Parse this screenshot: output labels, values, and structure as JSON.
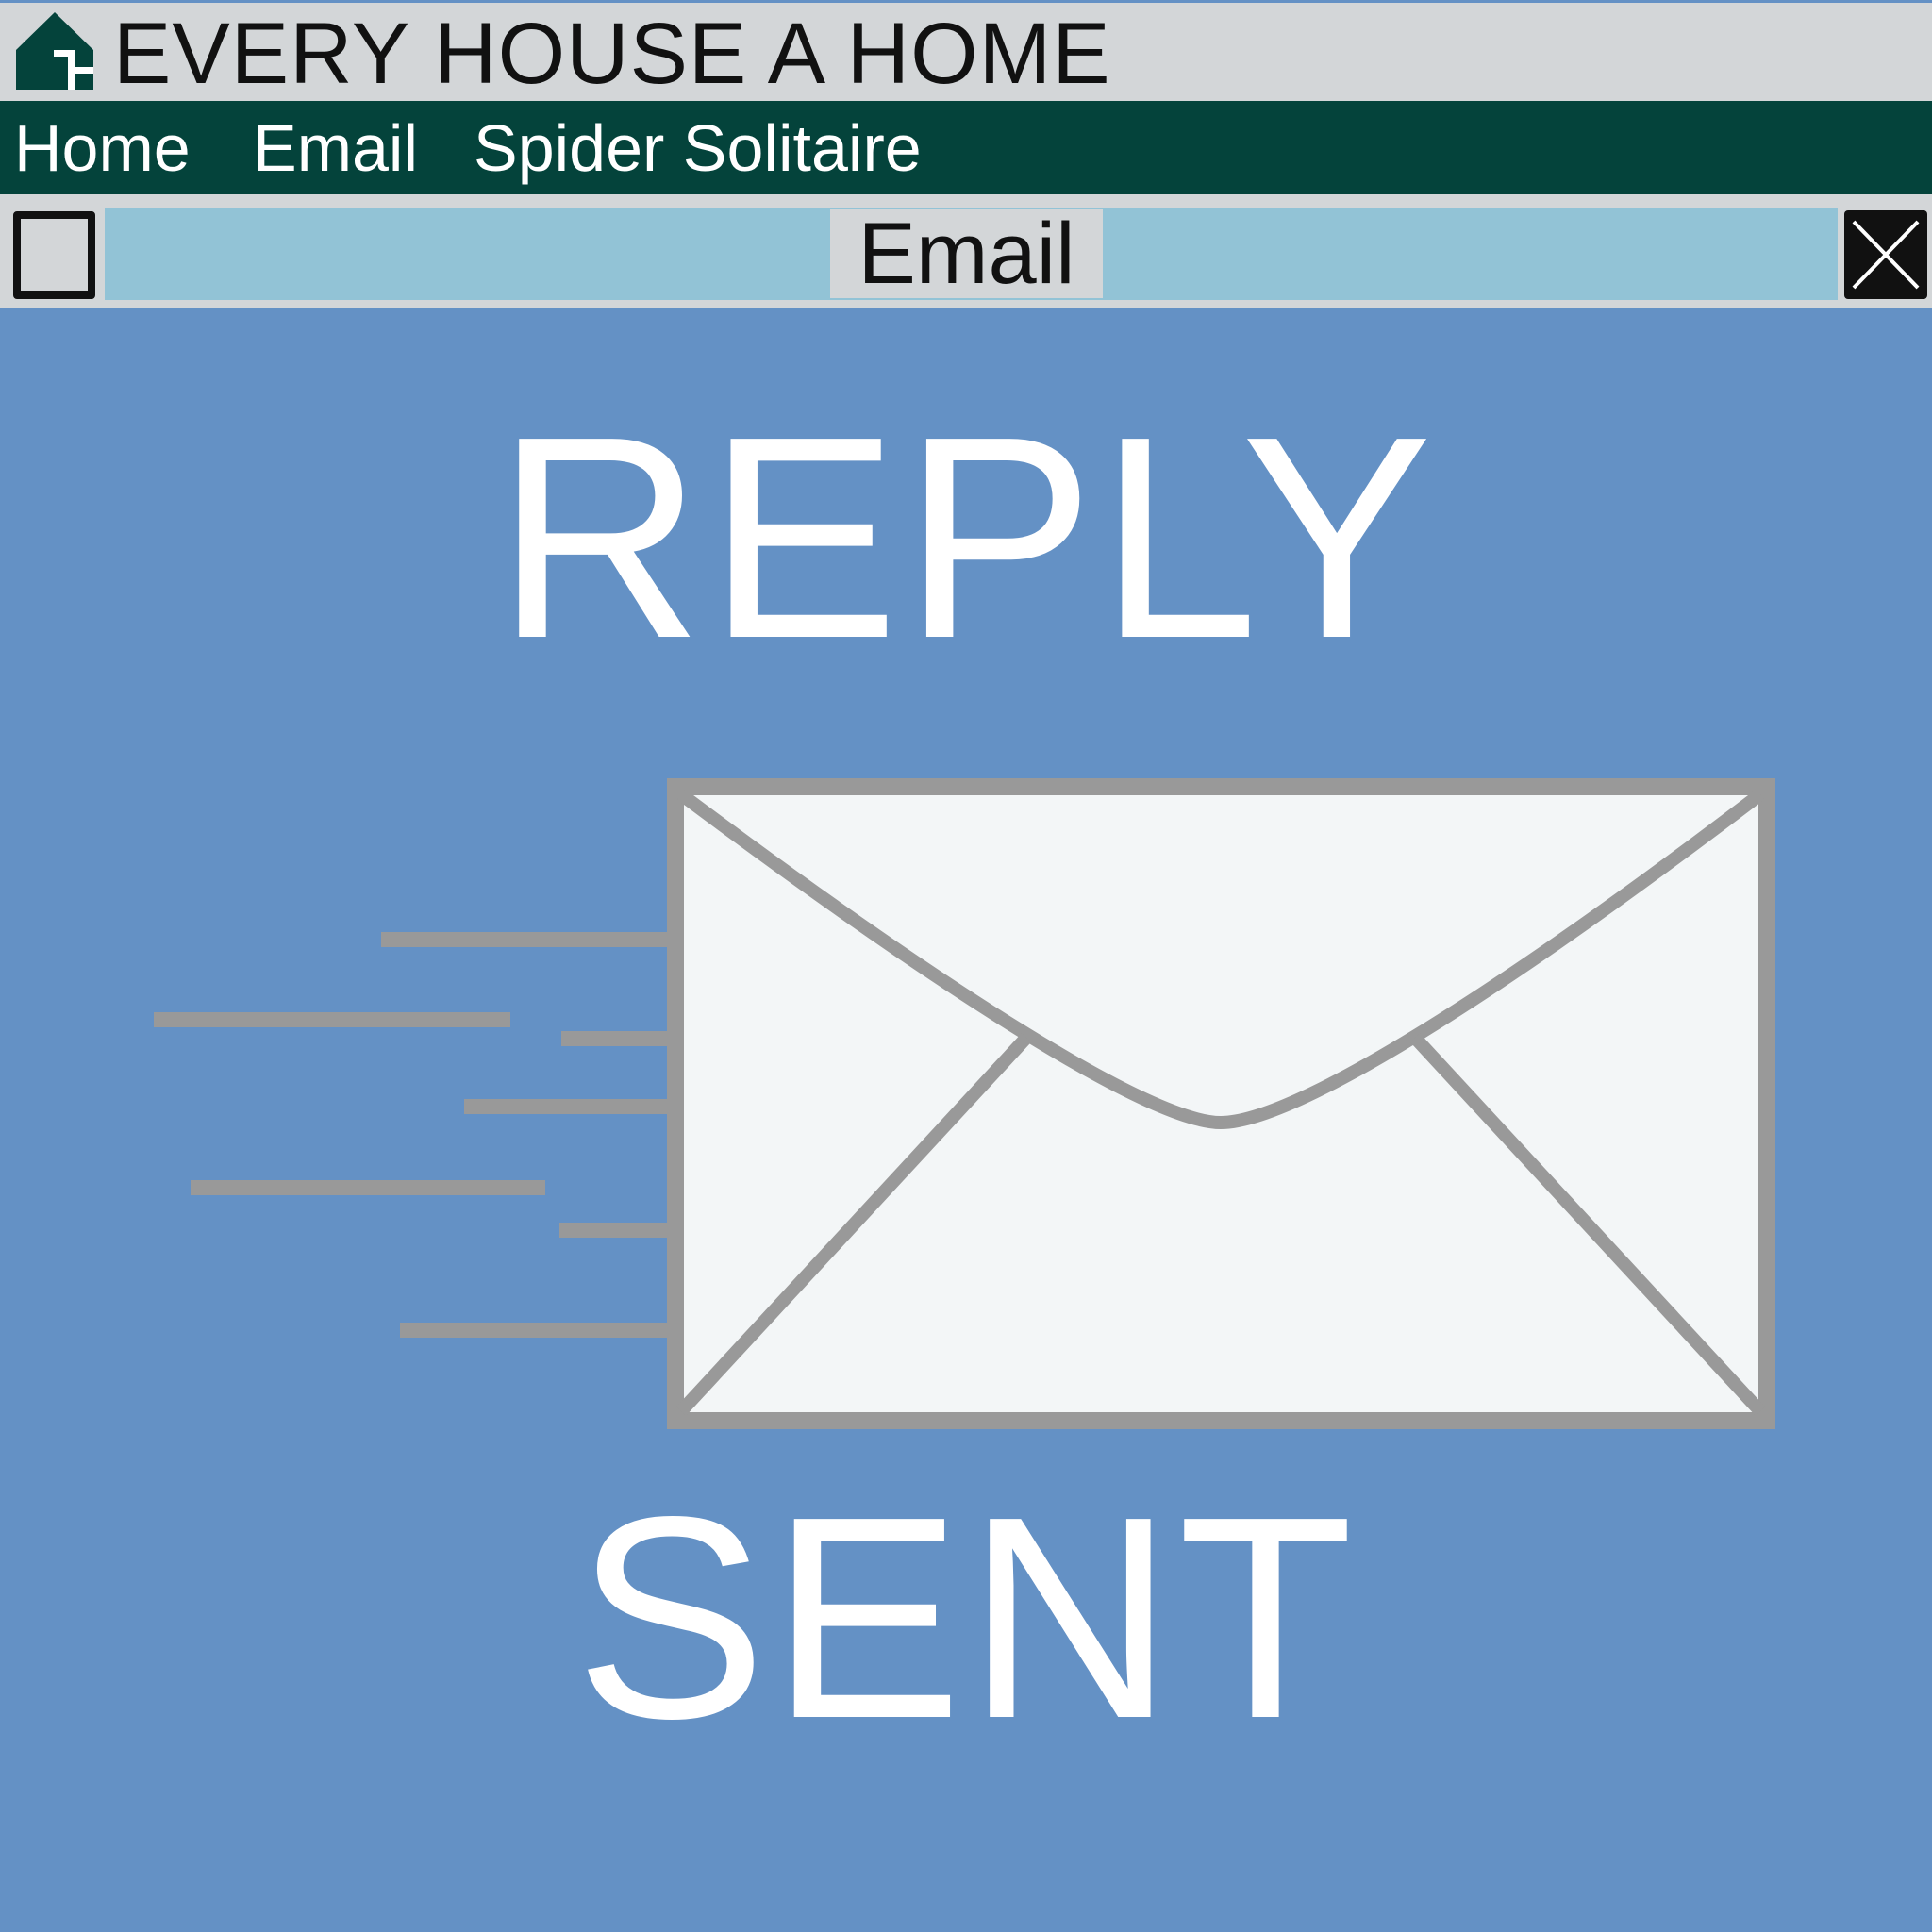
{
  "app": {
    "title": "EVERY HOUSE A HOME",
    "logo_icon": "house-icon"
  },
  "nav": {
    "items": [
      {
        "label": "Home"
      },
      {
        "label": "Email"
      },
      {
        "label": "Spider Solitaire"
      }
    ]
  },
  "window": {
    "title": "Email",
    "maximize_icon": "window-icon",
    "close_icon": "close-icon"
  },
  "content": {
    "heading_top": "REPLY",
    "heading_bottom": "SENT",
    "illustration_icon": "envelope-sent-icon"
  },
  "colors": {
    "brand_dark_green": "#04433b",
    "background_blue": "#6491c5",
    "window_strip": "#92c3d6",
    "chrome_gray": "#d3d6d8"
  }
}
